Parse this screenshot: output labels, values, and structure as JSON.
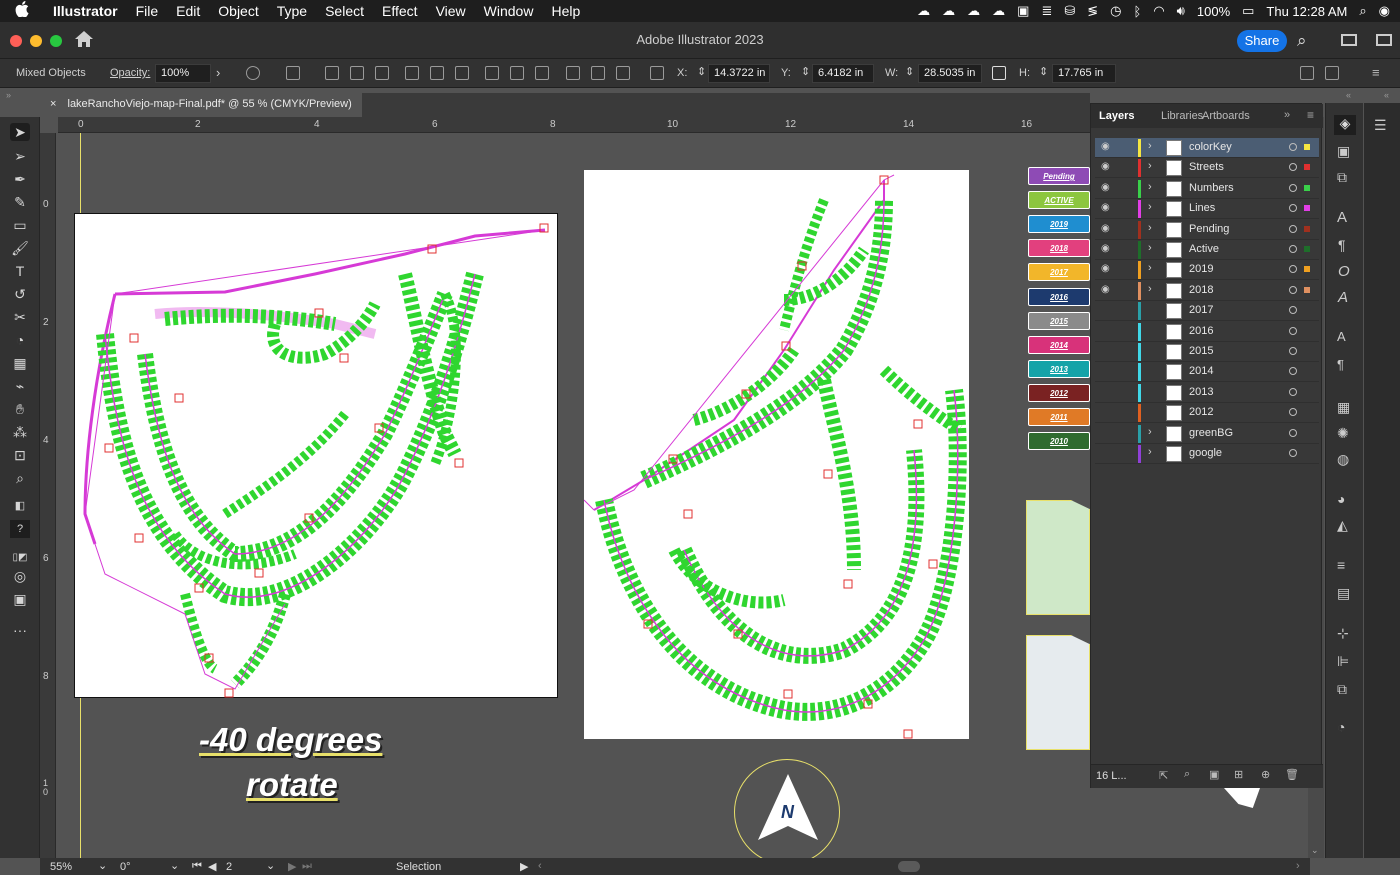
{
  "menubar": {
    "apple": "",
    "items": [
      "Illustrator",
      "File",
      "Edit",
      "Object",
      "Type",
      "Select",
      "Effect",
      "View",
      "Window",
      "Help"
    ],
    "battery": "100%",
    "clock": "Thu 12:28 AM"
  },
  "titlebar": {
    "title": "Adobe Illustrator 2023",
    "share": "Share"
  },
  "control": {
    "selection_type": "Mixed Objects",
    "opacity_label": "Opacity:",
    "opacity_value": "100%",
    "x_label": "X:",
    "x_value": "14.3722 in",
    "y_label": "Y:",
    "y_value": "6.4182 in",
    "w_label": "W:",
    "w_value": "28.5035 in",
    "h_label": "H:",
    "h_value": "17.765 in"
  },
  "document_tab": {
    "close": "×",
    "name": "lakeRanchoViejo-map-Final.pdf* @ 55 % (CMYK/Preview)"
  },
  "ruler": {
    "h_ticks": [
      "0",
      "2",
      "4",
      "6",
      "8",
      "10",
      "12",
      "14",
      "16"
    ],
    "v_ticks": [
      "0",
      "2",
      "4",
      "6",
      "8",
      "1\n0"
    ]
  },
  "layers_panel": {
    "tabs": [
      "Layers",
      "Libraries",
      "Artboards"
    ],
    "layers": [
      {
        "name": "colorKey",
        "color": "#f5e642",
        "visible": true,
        "expandable": true,
        "selected": true
      },
      {
        "name": "Streets",
        "color": "#e03030",
        "visible": true,
        "expandable": true
      },
      {
        "name": "Numbers",
        "color": "#3ad14a",
        "visible": true,
        "expandable": true
      },
      {
        "name": "Lines",
        "color": "#e23ee6",
        "visible": true,
        "expandable": true
      },
      {
        "name": "Pending",
        "color": "#a0301e",
        "visible": true,
        "expandable": true
      },
      {
        "name": "Active",
        "color": "#1e6e2a",
        "visible": true,
        "expandable": true
      },
      {
        "name": "2019",
        "color": "#f0a020",
        "visible": true,
        "expandable": true
      },
      {
        "name": "2018",
        "color": "#e09060",
        "visible": true,
        "expandable": true
      },
      {
        "name": "2017",
        "color": "#2aa0a8",
        "visible": false,
        "expandable": false
      },
      {
        "name": "2016",
        "color": "#40d8e8",
        "visible": false,
        "expandable": false
      },
      {
        "name": "2015",
        "color": "#40d8e8",
        "visible": false,
        "expandable": false
      },
      {
        "name": "2014",
        "color": "#40d8e8",
        "visible": false,
        "expandable": false
      },
      {
        "name": "2013",
        "color": "#40d8e8",
        "visible": false,
        "expandable": false
      },
      {
        "name": "2012",
        "color": "#e06020",
        "visible": false,
        "expandable": false
      },
      {
        "name": "greenBG",
        "color": "#2aa0a8",
        "visible": false,
        "expandable": true
      },
      {
        "name": "google",
        "color": "#9040d8",
        "visible": false,
        "expandable": true
      }
    ],
    "footer_count": "16 L..."
  },
  "color_key": [
    {
      "label": "Pending",
      "color": "#8e4bb5"
    },
    {
      "label": "ACTIVE",
      "color": "#8cc63f"
    },
    {
      "label": "2019",
      "color": "#1f8ed0"
    },
    {
      "label": "2018",
      "color": "#e2407e"
    },
    {
      "label": "2017",
      "color": "#f2b62a"
    },
    {
      "label": "2016",
      "color": "#1d3a6e"
    },
    {
      "label": "2015",
      "color": "#8a8a8a"
    },
    {
      "label": "2014",
      "color": "#d8327a"
    },
    {
      "label": "2013",
      "color": "#14a3a8"
    },
    {
      "label": "2012",
      "color": "#7a2222"
    },
    {
      "label": "2011",
      "color": "#e07a26"
    },
    {
      "label": "2010",
      "color": "#2f6b2f"
    }
  ],
  "canvas_text": {
    "rotate_line1": "-40 degrees",
    "rotate_line2": "rotate",
    "north": "N"
  },
  "statusbar": {
    "zoom": "55%",
    "rotation": "0°",
    "artboard": "2",
    "tool": "Selection"
  }
}
